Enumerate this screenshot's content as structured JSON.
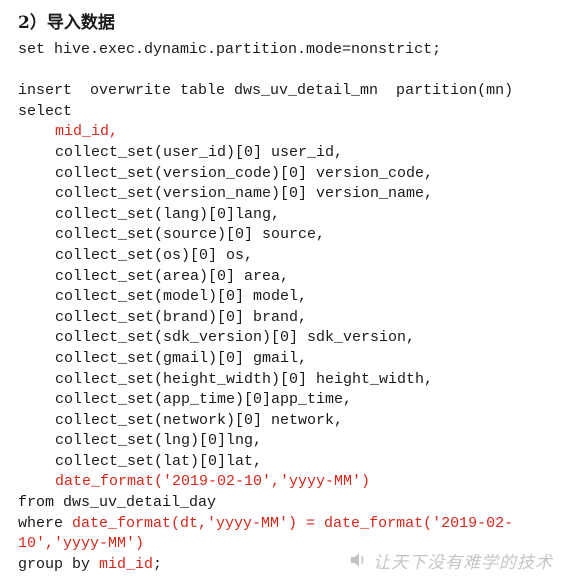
{
  "document": {
    "heading": "2）导入数据",
    "lines": [
      {
        "segments": [
          {
            "text": "set hive.exec.dynamic.partition.mode=nonstrict;",
            "color": "#1a1a1a"
          }
        ]
      },
      {
        "segments": []
      },
      {
        "segments": [
          {
            "text": "insert  overwrite table dws_uv_detail_mn  partition(mn)",
            "color": "#1a1a1a"
          }
        ]
      },
      {
        "segments": [
          {
            "text": "select",
            "color": "#1a1a1a"
          }
        ]
      },
      {
        "indent": true,
        "segments": [
          {
            "text": "mid_id,",
            "color": "#d8271b"
          }
        ]
      },
      {
        "indent": true,
        "segments": [
          {
            "text": "collect_set(user_id)[0] user_id,",
            "color": "#1a1a1a"
          }
        ]
      },
      {
        "indent": true,
        "segments": [
          {
            "text": "collect_set(version_code)[0] version_code,",
            "color": "#1a1a1a"
          }
        ]
      },
      {
        "indent": true,
        "segments": [
          {
            "text": "collect_set(version_name)[0] version_name,",
            "color": "#1a1a1a"
          }
        ]
      },
      {
        "indent": true,
        "segments": [
          {
            "text": "collect_set(lang)[0]lang,",
            "color": "#1a1a1a"
          }
        ]
      },
      {
        "indent": true,
        "segments": [
          {
            "text": "collect_set(source)[0] source,",
            "color": "#1a1a1a"
          }
        ]
      },
      {
        "indent": true,
        "segments": [
          {
            "text": "collect_set(os)[0] os,",
            "color": "#1a1a1a"
          }
        ]
      },
      {
        "indent": true,
        "segments": [
          {
            "text": "collect_set(area)[0] area,",
            "color": "#1a1a1a"
          }
        ]
      },
      {
        "indent": true,
        "segments": [
          {
            "text": "collect_set(model)[0] model,",
            "color": "#1a1a1a"
          }
        ]
      },
      {
        "indent": true,
        "segments": [
          {
            "text": "collect_set(brand)[0] brand,",
            "color": "#1a1a1a"
          }
        ]
      },
      {
        "indent": true,
        "segments": [
          {
            "text": "collect_set(sdk_version)[0] sdk_version,",
            "color": "#1a1a1a"
          }
        ]
      },
      {
        "indent": true,
        "segments": [
          {
            "text": "collect_set(gmail)[0] gmail,",
            "color": "#1a1a1a"
          }
        ]
      },
      {
        "indent": true,
        "segments": [
          {
            "text": "collect_set(height_width)[0] height_width,",
            "color": "#1a1a1a"
          }
        ]
      },
      {
        "indent": true,
        "segments": [
          {
            "text": "collect_set(app_time)[0]app_time,",
            "color": "#1a1a1a"
          }
        ]
      },
      {
        "indent": true,
        "segments": [
          {
            "text": "collect_set(network)[0] network,",
            "color": "#1a1a1a"
          }
        ]
      },
      {
        "indent": true,
        "segments": [
          {
            "text": "collect_set(lng)[0]lng,",
            "color": "#1a1a1a"
          }
        ]
      },
      {
        "indent": true,
        "segments": [
          {
            "text": "collect_set(lat)[0]lat,",
            "color": "#1a1a1a"
          }
        ]
      },
      {
        "indent": true,
        "segments": [
          {
            "text": "date_format('2019-02-10','yyyy-MM')",
            "color": "#d8271b"
          }
        ]
      },
      {
        "segments": [
          {
            "text": "from dws_uv_detail_day",
            "color": "#1a1a1a"
          }
        ]
      },
      {
        "segments": [
          {
            "text": "where ",
            "color": "#1a1a1a"
          },
          {
            "text": "date_format(dt,'yyyy-MM') = date_format('2019-02-",
            "color": "#d8271b"
          }
        ]
      },
      {
        "segments": [
          {
            "text": "10','yyyy-MM')",
            "color": "#d8271b"
          }
        ]
      },
      {
        "segments": [
          {
            "text": "group by ",
            "color": "#1a1a1a"
          },
          {
            "text": "mid_id",
            "color": "#d8271b"
          },
          {
            "text": ";",
            "color": "#1a1a1a"
          }
        ]
      }
    ]
  },
  "watermark": {
    "text": "让天下没有难学的技术",
    "icon": "speaker-icon"
  }
}
